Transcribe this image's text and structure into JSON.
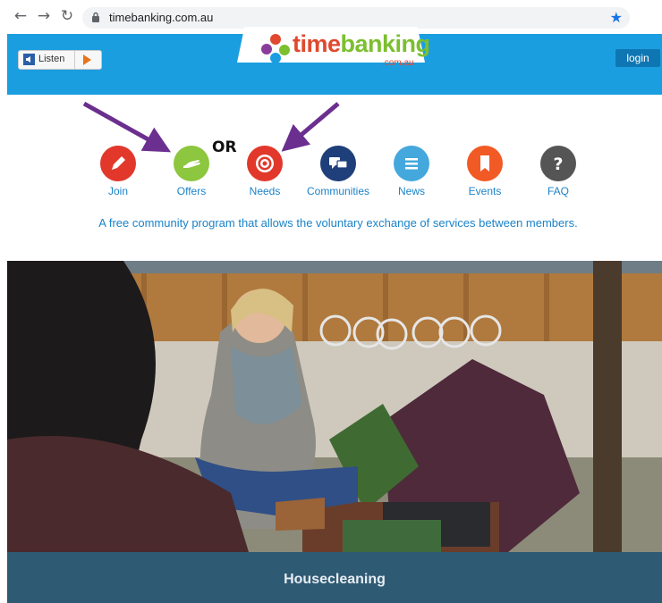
{
  "browser": {
    "url": "timebanking.com.au",
    "back_icon": "arrow-left-icon",
    "forward_icon": "arrow-right-icon",
    "reload_icon": "reload-icon",
    "star_icon": "star-icon"
  },
  "header": {
    "listen_label": "Listen",
    "login_label": "login",
    "logo_word_a": "time",
    "logo_word_b": "banking",
    "logo_sub": ".com.au",
    "bg_color": "#1b9ee0"
  },
  "overlay": {
    "or_text": "OR"
  },
  "nav": [
    {
      "label": "Join",
      "icon": "pencil-icon",
      "color": "#e1382b"
    },
    {
      "label": "Offers",
      "icon": "hand-icon",
      "color": "#8dc63f"
    },
    {
      "label": "Needs",
      "icon": "target-icon",
      "color": "#e1382b"
    },
    {
      "label": "Communities",
      "icon": "chat-icon",
      "color": "#1f3f7a"
    },
    {
      "label": "News",
      "icon": "list-icon",
      "color": "#44a8dc"
    },
    {
      "label": "Events",
      "icon": "bookmark-icon",
      "color": "#f15a24"
    },
    {
      "label": "FAQ",
      "icon": "question-icon",
      "color": "#555555"
    }
  ],
  "tagline": "A free community program that allows the voluntary exchange of services between members.",
  "hero": {
    "caption": "Housecleaning",
    "caption_color": "#2f5a74"
  }
}
